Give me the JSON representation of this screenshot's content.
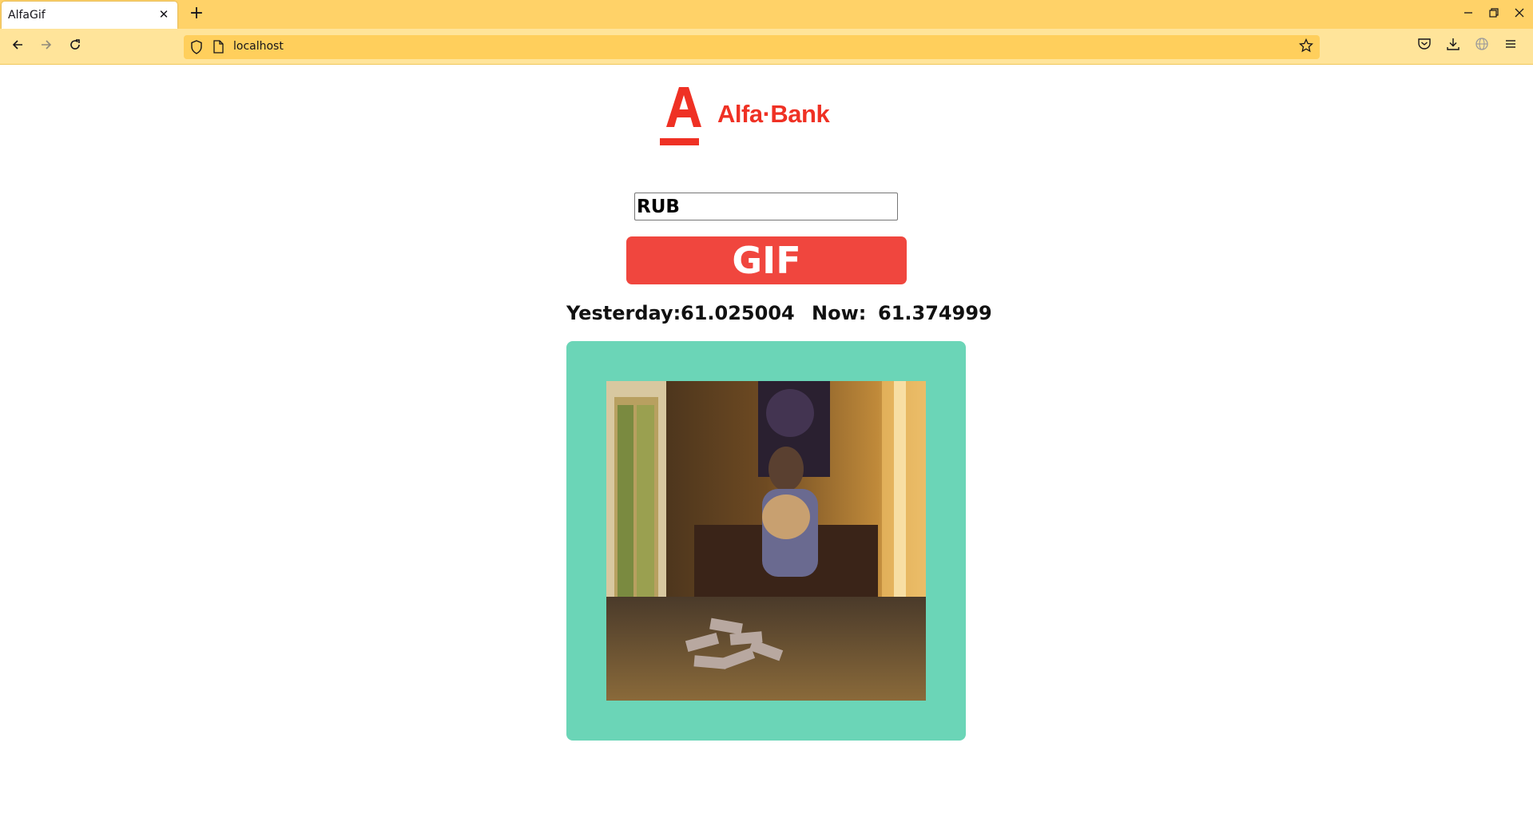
{
  "browser": {
    "tab_title": "AlfaGif",
    "url": "localhost",
    "tab_close": "✕",
    "new_tab": "+"
  },
  "page": {
    "logo_text": "Alfa·Bank",
    "currency_input_value": "RUB",
    "gif_button_label": "GIF",
    "yesterday_label": "Yesterday:",
    "yesterday_value": "61.025004",
    "now_label": "Now:",
    "now_value": "61.374999"
  },
  "colors": {
    "brand_red": "#ef3124",
    "button_red": "#f0463e",
    "frame_teal": "#6bd5b7",
    "chrome_yellow": "#ffd268"
  }
}
